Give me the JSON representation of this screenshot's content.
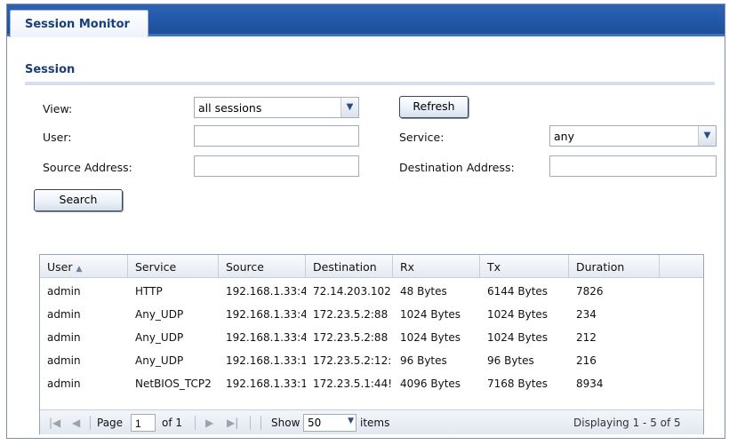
{
  "tabs": [
    {
      "label": "Session Monitor"
    }
  ],
  "section": {
    "title": "Session"
  },
  "form": {
    "view_label": "View:",
    "view_value": "all sessions",
    "refresh_label": "Refresh",
    "user_label": "User:",
    "user_value": "",
    "service_label": "Service:",
    "service_value": "any",
    "source_label": "Source Address:",
    "source_value": "",
    "destination_label": "Destination Address:",
    "destination_value": "",
    "search_label": "Search"
  },
  "table": {
    "columns": [
      "User",
      "Service",
      "Source",
      "Destination",
      "Rx",
      "Tx",
      "Duration"
    ],
    "sort_indicator": "▲",
    "rows": [
      [
        "admin",
        "HTTP",
        "192.168.1.33:4",
        "72.14.203.102",
        "48 Bytes",
        "6144 Bytes",
        "7826"
      ],
      [
        "admin",
        "Any_UDP",
        "192.168.1.33:4",
        "172.23.5.2:88",
        "1024 Bytes",
        "1024 Bytes",
        "234"
      ],
      [
        "admin",
        "Any_UDP",
        "192.168.1.33:4",
        "172.23.5.2:88",
        "1024 Bytes",
        "1024 Bytes",
        "212"
      ],
      [
        "admin",
        "Any_UDP",
        "192.168.1.33:1",
        "172.23.5.2:12:",
        "96 Bytes",
        "96 Bytes",
        "216"
      ],
      [
        "admin",
        "NetBIOS_TCP2",
        "192.168.1.33:1",
        "172.23.5.1:44!",
        "4096 Bytes",
        "7168 Bytes",
        "8934"
      ]
    ]
  },
  "pager": {
    "first_icon": "|◀",
    "prev_icon": "◀",
    "page_label": "Page",
    "page_value": "1",
    "of_label": "of 1",
    "next_icon": "▶",
    "last_icon": "▶|",
    "show_label": "Show",
    "show_value": "50",
    "items_label": "items",
    "displaying": "Displaying 1 - 5 of 5"
  }
}
